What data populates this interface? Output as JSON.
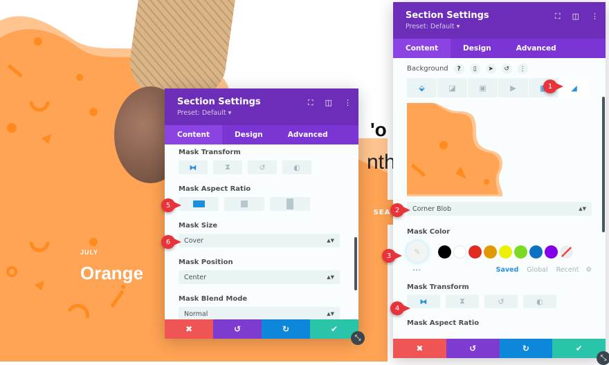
{
  "page": {
    "month_label": "JULY",
    "heading": "Orange",
    "partial_heading_1": "'o",
    "partial_heading_2": "nth",
    "partial_button": "SEA"
  },
  "colors": {
    "header": "#6c2eb9",
    "tabs": "#7b35d4",
    "active_tab": "#8b44e3",
    "orange": "#ffa354",
    "cancel": "#ef5555",
    "undo": "#7e3bd0",
    "redo": "#0c87d9",
    "save": "#29c4a9",
    "accent": "#2a8fdb"
  },
  "panel_back": {
    "title": "Section Settings",
    "preset": "Preset: Default ▾",
    "tabs": [
      {
        "label": "Content",
        "active": true
      },
      {
        "label": "Design",
        "active": false
      },
      {
        "label": "Advanced",
        "active": false
      }
    ],
    "mask_transform_label": "Mask Transform",
    "mask_aspect_ratio_label": "Mask Aspect Ratio",
    "mask_size_label": "Mask Size",
    "mask_size_value": "Cover",
    "mask_position_label": "Mask Position",
    "mask_position_value": "Center",
    "mask_blend_label": "Mask Blend Mode",
    "mask_blend_value": "Normal",
    "badges": [
      "5",
      "6"
    ]
  },
  "panel_front": {
    "title": "Section Settings",
    "preset": "Preset: Default ▾",
    "tabs": [
      {
        "label": "Content",
        "active": true
      },
      {
        "label": "Design",
        "active": false
      },
      {
        "label": "Advanced",
        "active": false
      }
    ],
    "background_label": "Background",
    "mask_style_value": "Corner Blob",
    "mask_color_label": "Mask Color",
    "swatches": [
      "#000000",
      "#ffffff",
      "#e02b20",
      "#e09900",
      "#edf000",
      "#7cda24",
      "#0c71c3",
      "#8300e9"
    ],
    "palette_tabs": [
      "Saved",
      "Global",
      "Recent"
    ],
    "more_dots": "•••",
    "mask_transform_label": "Mask Transform",
    "mask_aspect_ratio_label": "Mask Aspect Ratio",
    "badges": [
      "1",
      "2",
      "3",
      "4"
    ]
  },
  "icons": {
    "close": "✖",
    "undo": "↺",
    "redo": "↻",
    "check": "✔",
    "dots": "⋮",
    "help": "?",
    "gear": "⚙"
  }
}
